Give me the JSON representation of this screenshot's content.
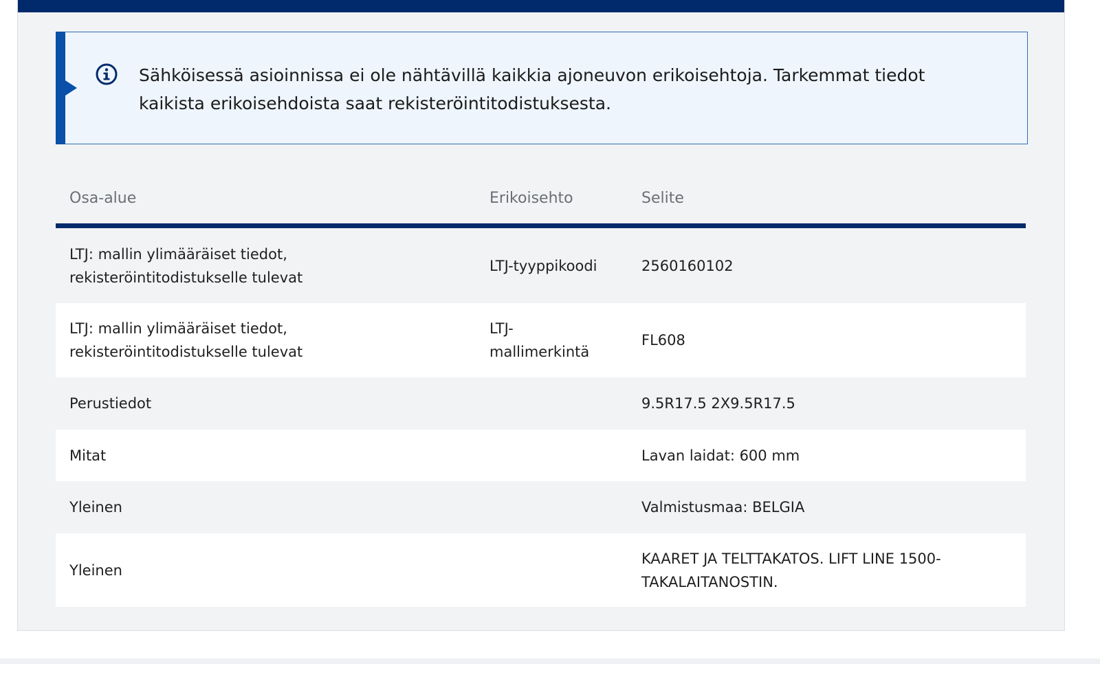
{
  "notice": {
    "icon": "info-icon",
    "text": "Sähköisessä asioinnissa ei ole nähtävillä kaikkia ajoneuvon erikoisehtoja. Tarkemmat tiedot kaikista erikoisehdoista saat rekisteröintitodistuksesta."
  },
  "table": {
    "headers": {
      "area": "Osa-alue",
      "condition": "Erikoisehto",
      "description": "Selite"
    },
    "rows": [
      {
        "area": "LTJ: mallin ylimääräiset tiedot, rekisteröintitodistukselle tulevat",
        "condition": "LTJ-tyyppikoodi",
        "description": "2560160102"
      },
      {
        "area": "LTJ: mallin ylimääräiset tiedot, rekisteröintitodistukselle tulevat",
        "condition": "LTJ-mallimerkintä",
        "description": "FL608"
      },
      {
        "area": "Perustiedot",
        "condition": "",
        "description": "9.5R17.5 2X9.5R17.5"
      },
      {
        "area": "Mitat",
        "condition": "",
        "description": "Lavan laidat: 600 mm"
      },
      {
        "area": "Yleinen",
        "condition": "",
        "description": "Valmistusmaa: BELGIA"
      },
      {
        "area": "Yleinen",
        "condition": "",
        "description": "KAARET JA TELTTAKATOS. LIFT LINE 1500-TAKALAITANOSTIN."
      }
    ]
  },
  "colors": {
    "brand_navy": "#002a6c",
    "info_blue": "#0a4fa8",
    "notice_bg": "#eef5fd"
  }
}
